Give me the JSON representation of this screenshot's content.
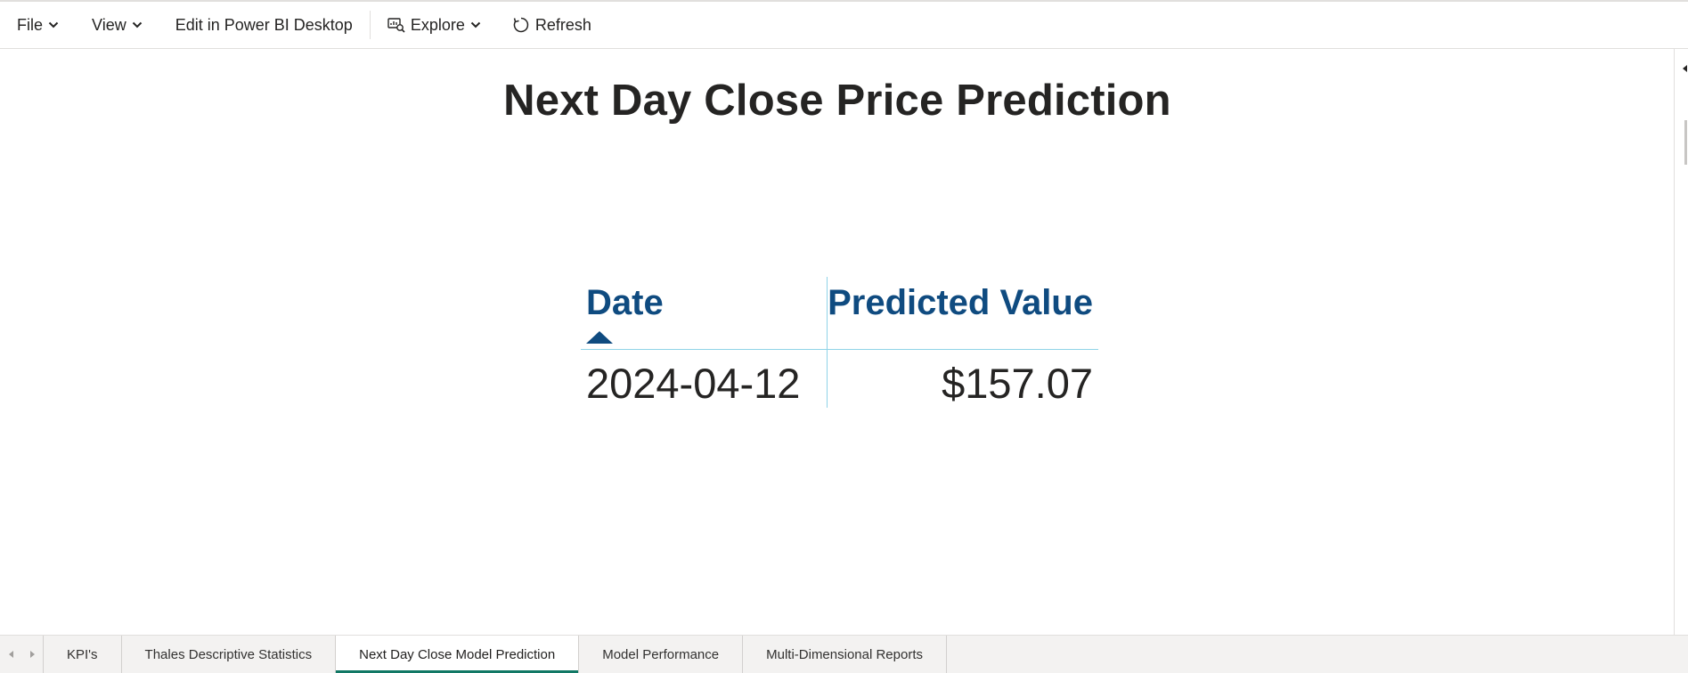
{
  "toolbar": {
    "file_label": "File",
    "view_label": "View",
    "edit_label": "Edit in Power BI Desktop",
    "explore_label": "Explore",
    "refresh_label": "Refresh",
    "icons": {
      "chevron": "chevron-down-icon",
      "explore": "explore-icon",
      "refresh": "refresh-icon"
    }
  },
  "report": {
    "title": "Next Day Close Price Prediction",
    "table": {
      "columns": [
        "Date",
        "Predicted Value"
      ],
      "sort": {
        "column": "Date",
        "direction": "ascending"
      },
      "rows": [
        {
          "date": "2024-04-12",
          "predicted_value": "$157.07"
        }
      ]
    }
  },
  "page_tabs": {
    "items": [
      {
        "label": "KPI's",
        "active": false
      },
      {
        "label": "Thales Descriptive Statistics",
        "active": false
      },
      {
        "label": "Next Day Close Model Prediction",
        "active": true
      },
      {
        "label": "Model Performance",
        "active": false
      },
      {
        "label": "Multi-Dimensional Reports",
        "active": false
      }
    ]
  },
  "colors": {
    "header_text": "#0f4b80",
    "grid_lines": "#8fd3e8",
    "active_tab_indicator": "#117865",
    "tab_bar_bg": "#f3f2f1"
  }
}
